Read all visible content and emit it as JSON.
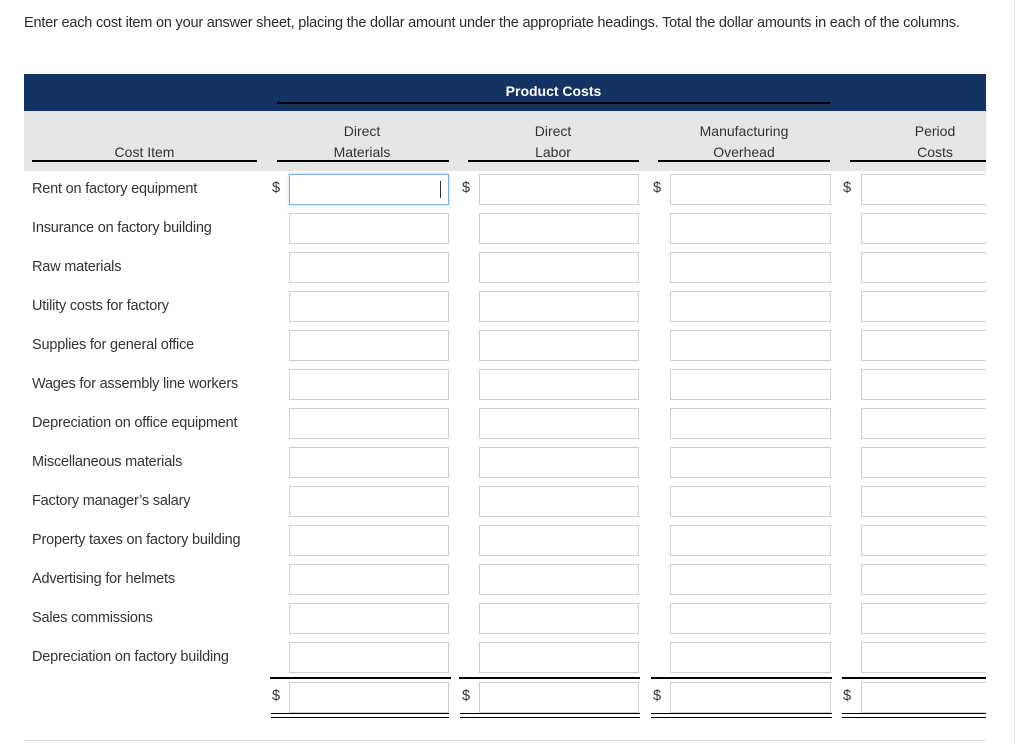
{
  "instructions": "Enter each cost item on your answer sheet, placing the dollar amount under the appropriate headings. Total the dollar amounts in each of the columns.",
  "table": {
    "group_header": "Product Costs",
    "columns": {
      "cost_item": "Cost Item",
      "direct_materials": [
        "Direct",
        "Materials"
      ],
      "direct_labor": [
        "Direct",
        "Labor"
      ],
      "manufacturing_overhead": [
        "Manufacturing",
        "Overhead"
      ],
      "period_costs": [
        "Period",
        "Costs"
      ]
    },
    "currency_symbol": "$",
    "rows": [
      {
        "label": "Rent on factory equipment",
        "direct_materials": "",
        "direct_labor": "",
        "manufacturing_overhead": "",
        "period_costs": ""
      },
      {
        "label": "Insurance on factory building",
        "direct_materials": "",
        "direct_labor": "",
        "manufacturing_overhead": "",
        "period_costs": ""
      },
      {
        "label": "Raw materials",
        "direct_materials": "",
        "direct_labor": "",
        "manufacturing_overhead": "",
        "period_costs": ""
      },
      {
        "label": "Utility costs for factory",
        "direct_materials": "",
        "direct_labor": "",
        "manufacturing_overhead": "",
        "period_costs": ""
      },
      {
        "label": "Supplies for general office",
        "direct_materials": "",
        "direct_labor": "",
        "manufacturing_overhead": "",
        "period_costs": ""
      },
      {
        "label": "Wages for assembly line workers",
        "direct_materials": "",
        "direct_labor": "",
        "manufacturing_overhead": "",
        "period_costs": ""
      },
      {
        "label": "Depreciation on office equipment",
        "direct_materials": "",
        "direct_labor": "",
        "manufacturing_overhead": "",
        "period_costs": ""
      },
      {
        "label": "Miscellaneous materials",
        "direct_materials": "",
        "direct_labor": "",
        "manufacturing_overhead": "",
        "period_costs": ""
      },
      {
        "label": "Factory manager’s salary",
        "direct_materials": "",
        "direct_labor": "",
        "manufacturing_overhead": "",
        "period_costs": ""
      },
      {
        "label": "Property taxes on factory building",
        "direct_materials": "",
        "direct_labor": "",
        "manufacturing_overhead": "",
        "period_costs": ""
      },
      {
        "label": "Advertising for helmets",
        "direct_materials": "",
        "direct_labor": "",
        "manufacturing_overhead": "",
        "period_costs": ""
      },
      {
        "label": "Sales commissions",
        "direct_materials": "",
        "direct_labor": "",
        "manufacturing_overhead": "",
        "period_costs": ""
      },
      {
        "label": "Depreciation on factory building",
        "direct_materials": "",
        "direct_labor": "",
        "manufacturing_overhead": "",
        "period_costs": ""
      }
    ],
    "totals": {
      "direct_materials": "",
      "direct_labor": "",
      "manufacturing_overhead": "",
      "period_costs": ""
    },
    "focused_cell": "rows.0.direct_materials"
  },
  "colors": {
    "header_navy": "#133463",
    "subheader_gray": "#e6e6e6",
    "focus_blue": "#7fb0e0"
  }
}
